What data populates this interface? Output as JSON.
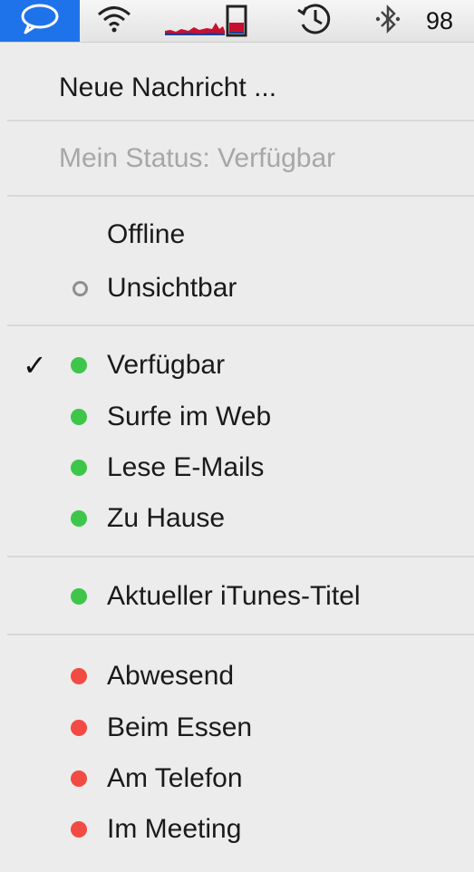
{
  "menubar": {
    "clock_text": "98"
  },
  "menu": {
    "new_message": "Neue Nachricht ...",
    "my_status": "Mein Status: Verfügbar",
    "offline": "Offline",
    "invisible": "Unsichtbar",
    "available": "Verfügbar",
    "available_checkmark": "✓",
    "surfing": "Surfe im Web",
    "reading_mail": "Lese E-Mails",
    "at_home": "Zu Hause",
    "itunes_title": "Aktueller iTunes-Titel",
    "away": "Abwesend",
    "eating": "Beim Essen",
    "on_phone": "Am Telefon",
    "in_meeting": "Im Meeting"
  },
  "colors": {
    "available": "#3ec64a",
    "away": "#f24b43",
    "highlight": "#1f73ea"
  }
}
